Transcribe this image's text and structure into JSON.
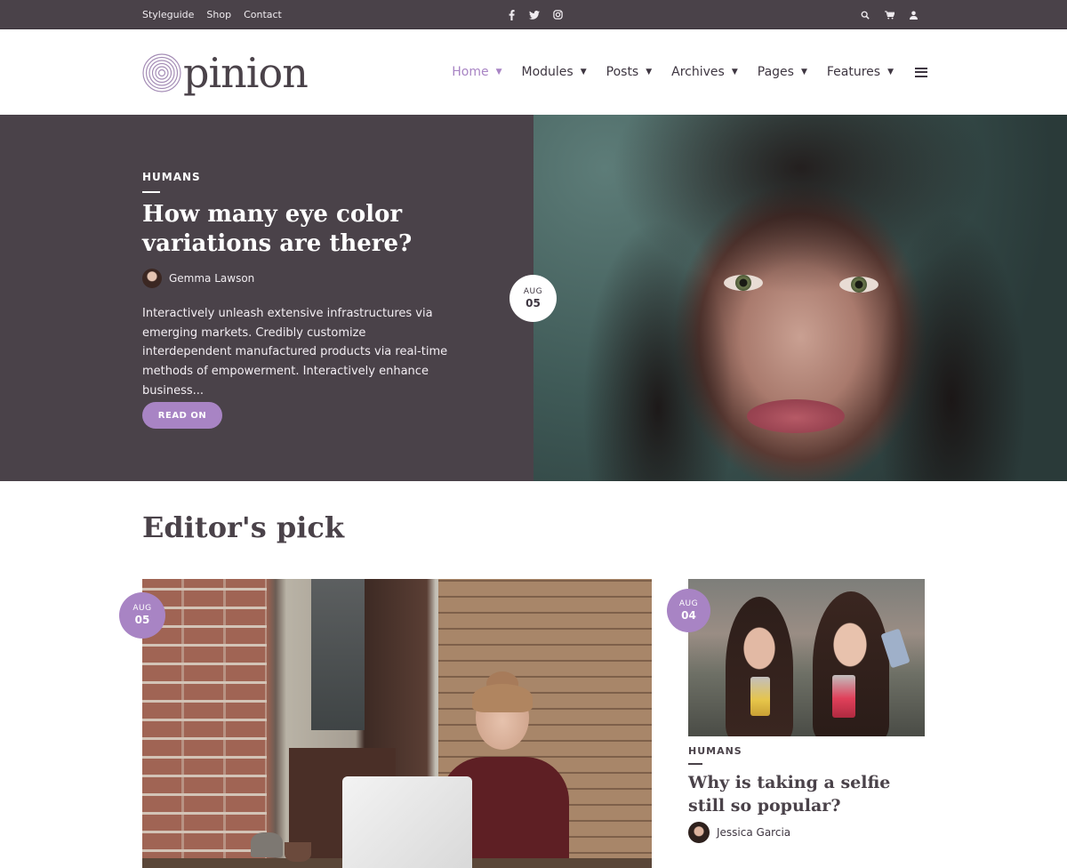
{
  "topbar": {
    "links": [
      "Styleguide",
      "Shop",
      "Contact"
    ],
    "social_icons": [
      "facebook-icon",
      "twitter-icon",
      "instagram-icon"
    ],
    "tool_icons": [
      "search-icon",
      "cart-icon",
      "user-icon"
    ]
  },
  "header": {
    "logo_text": "pinion",
    "nav": [
      {
        "label": "Home",
        "active": true
      },
      {
        "label": "Modules",
        "active": false
      },
      {
        "label": "Posts",
        "active": false
      },
      {
        "label": "Archives",
        "active": false
      },
      {
        "label": "Pages",
        "active": false
      },
      {
        "label": "Features",
        "active": false
      }
    ],
    "caret": "▼"
  },
  "hero": {
    "category": "HUMANS",
    "title": "How many eye color variations are there?",
    "author": "Gemma Lawson",
    "excerpt": "Interactively unleash extensive infrastructures via emerging markets. Credibly customize interdependent manufactured products via real-time methods of empowerment. Interactively enhance business...",
    "button": "READ ON",
    "date": {
      "month": "AUG",
      "day": "05"
    }
  },
  "editors_pick": {
    "title": "Editor's pick",
    "main_post": {
      "date": {
        "month": "AUG",
        "day": "05"
      }
    },
    "side_post": {
      "date": {
        "month": "AUG",
        "day": "04"
      },
      "category": "HUMANS",
      "title": "Why is taking a selfie still so popular?",
      "author": "Jessica Garcia"
    }
  },
  "colors": {
    "accent": "#a884c4",
    "dark": "#4a4249",
    "text": "#3e3641"
  }
}
